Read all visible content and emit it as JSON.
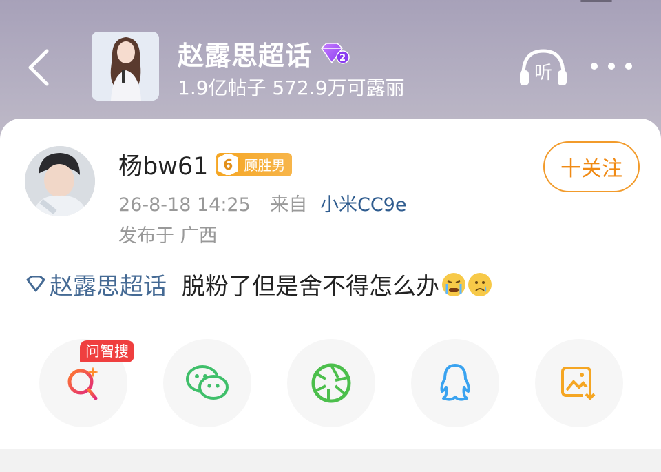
{
  "header": {
    "topic_title": "赵露思超话",
    "gem_level": "2",
    "topic_stats": "1.9亿帖子 572.9万可露丽",
    "listen_label": "听"
  },
  "post": {
    "username": "杨bw61",
    "level": "6",
    "badge_label": "顾胜男",
    "timestamp": "26-8-18 14:25",
    "from_prefix": "来自",
    "device": "小米CC9e",
    "location": "发布于 广西",
    "follow_label": "十关注",
    "topic_link": "赵露思超话",
    "text": "脱粉了但是舍不得怎么办"
  },
  "share": {
    "ai_tag": "问智搜",
    "items": [
      "ai-search",
      "wechat",
      "moments",
      "qq",
      "save-image"
    ]
  },
  "colors": {
    "accent_orange": "#f08a14",
    "link_blue": "#456a94",
    "ai_red": "#ef3f3f"
  }
}
